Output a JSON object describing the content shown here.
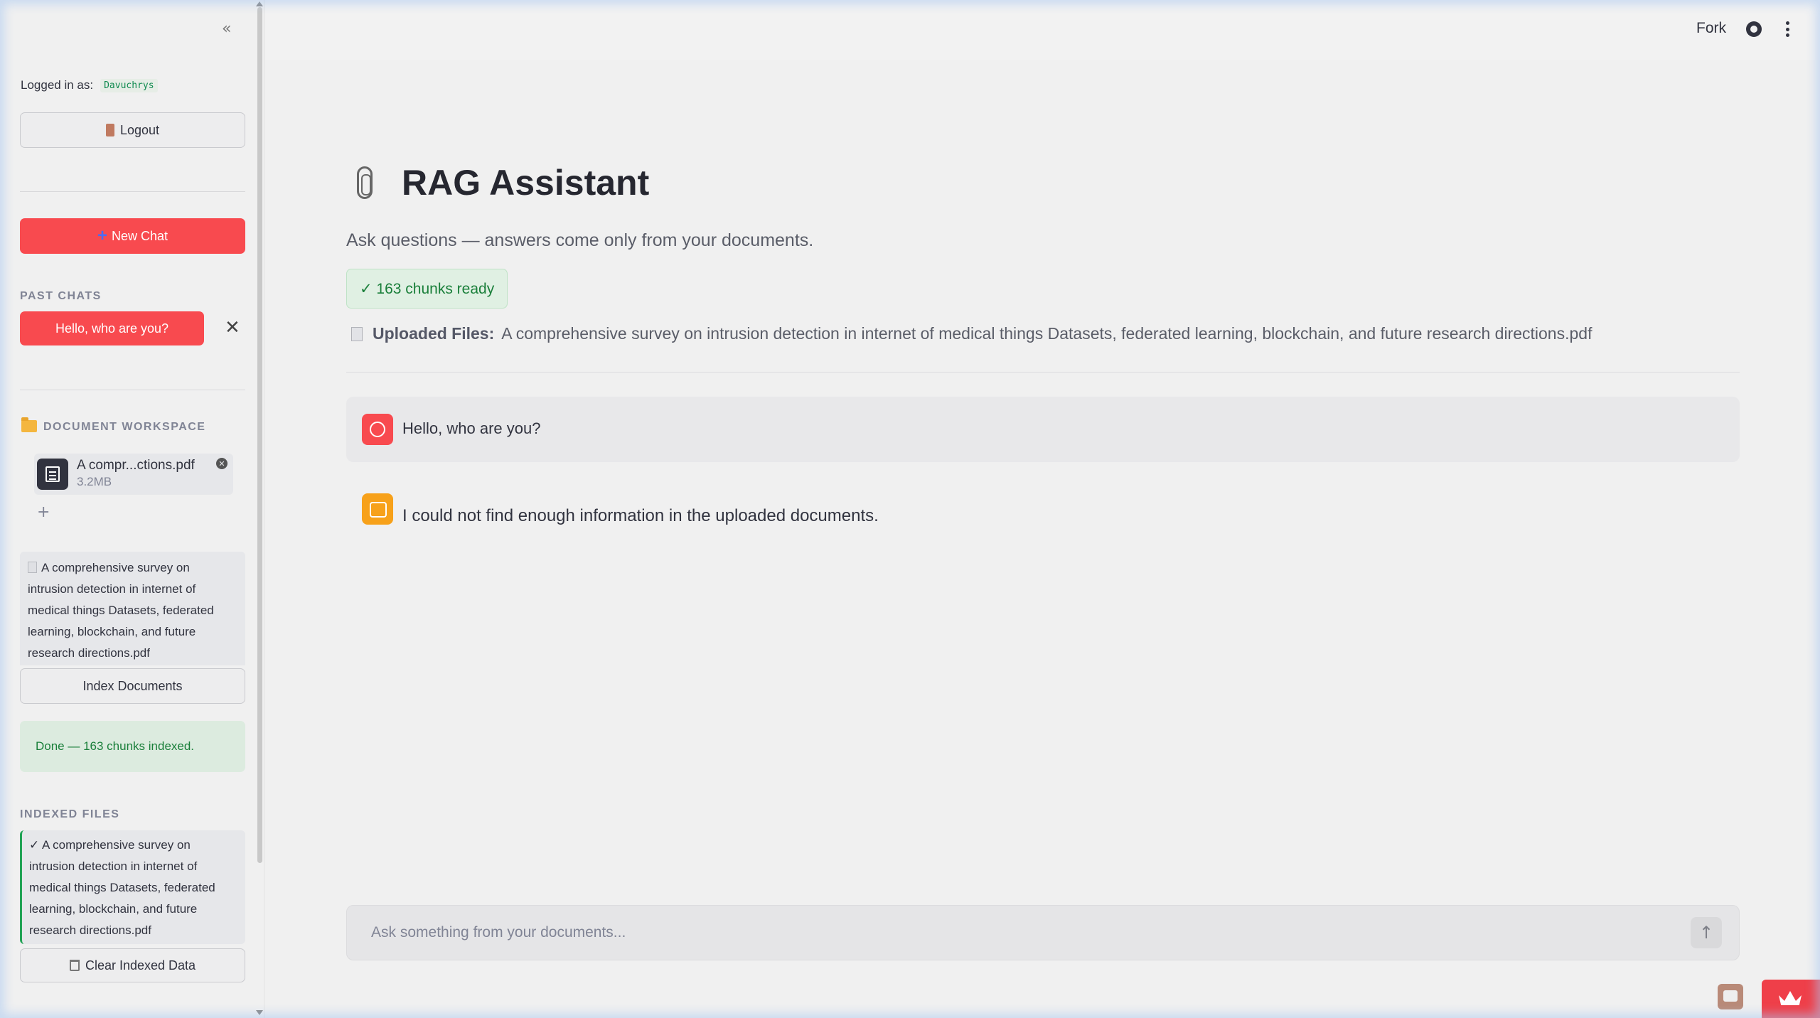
{
  "sidebar": {
    "collapse_icon": "«",
    "logged_in_label": "Logged in as:",
    "username": "Davuchrys",
    "logout_label": "Logout",
    "new_chat_label": "New Chat",
    "past_chats_label": "PAST CHATS",
    "past_chats": [
      {
        "label": "Hello, who are you?"
      }
    ],
    "close_icon": "✕",
    "workspace_label": "DOCUMENT WORKSPACE",
    "uploaded_file": {
      "name": "A compr...ctions.pdf",
      "size": "3.2MB",
      "remove_icon": "✕"
    },
    "add_icon": "+",
    "document_list_text": "A comprehensive survey on intrusion detection in internet of medical things Datasets, federated learning, blockchain, and future research directions.pdf",
    "index_button_label": "Index Documents",
    "done_message": "Done — 163 chunks indexed.",
    "indexed_files_label": "INDEXED FILES",
    "indexed_files_text": "✓ A comprehensive survey on intrusion detection in internet of medical things Datasets, federated learning, blockchain, and future research directions.pdf",
    "clear_button_label": "Clear Indexed Data"
  },
  "header": {
    "fork_label": "Fork",
    "icons": [
      "github-icon",
      "menu-icon"
    ]
  },
  "main": {
    "title": "RAG Assistant",
    "subtitle": "Ask questions — answers come only from your documents.",
    "ready_badge": "✓ 163 chunks ready",
    "uploaded_files_label": "Uploaded Files:",
    "uploaded_files_value": "A comprehensive survey on intrusion detection in internet of medical things Datasets, federated learning, blockchain, and future research directions.pdf",
    "messages": [
      {
        "role": "user",
        "text": "Hello, who are you?"
      },
      {
        "role": "assistant",
        "text": "I could not find enough information in the uploaded documents."
      }
    ],
    "chat_input": {
      "placeholder": "Ask something from your documents...",
      "send_icon": "↑"
    }
  },
  "colors": {
    "primary": "#f84a4f",
    "success": "#1a7f3a",
    "assistant_avatar": "#f7a11a",
    "background": "#f0f0f0"
  }
}
